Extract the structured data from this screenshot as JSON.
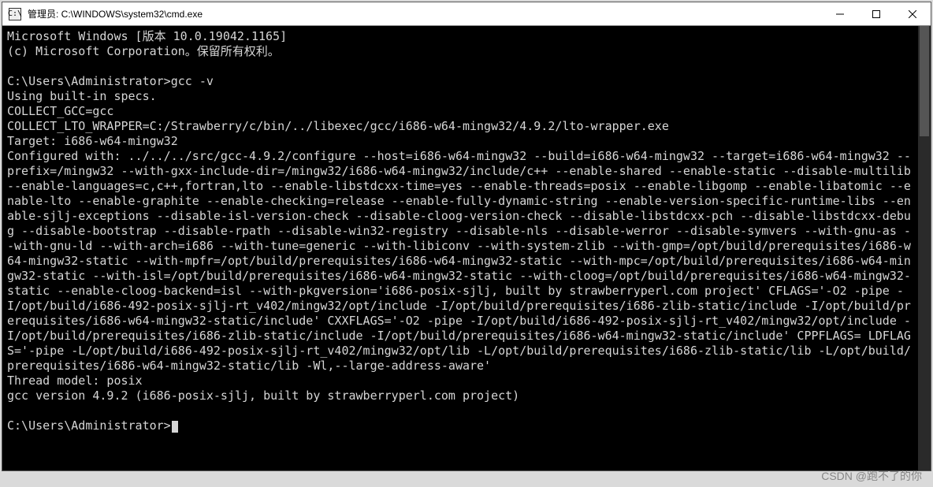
{
  "titlebar": {
    "icon_label": "C:\\",
    "title": "管理员: C:\\WINDOWS\\system32\\cmd.exe"
  },
  "terminal": {
    "line1": "Microsoft Windows [版本 10.0.19042.1165]",
    "line2": "(c) Microsoft Corporation。保留所有权利。",
    "blank1": "",
    "prompt1": "C:\\Users\\Administrator>gcc -v",
    "spec": "Using built-in specs.",
    "collect_gcc": "COLLECT_GCC=gcc",
    "collect_lto": "COLLECT_LTO_WRAPPER=C:/Strawberry/c/bin/../libexec/gcc/i686-w64-mingw32/4.9.2/lto-wrapper.exe",
    "target": "Target: i686-w64-mingw32",
    "configured": "Configured with: ../../../src/gcc-4.9.2/configure --host=i686-w64-mingw32 --build=i686-w64-mingw32 --target=i686-w64-mingw32 --prefix=/mingw32 --with-gxx-include-dir=/mingw32/i686-w64-mingw32/include/c++ --enable-shared --enable-static --disable-multilib --enable-languages=c,c++,fortran,lto --enable-libstdcxx-time=yes --enable-threads=posix --enable-libgomp --enable-libatomic --enable-lto --enable-graphite --enable-checking=release --enable-fully-dynamic-string --enable-version-specific-runtime-libs --enable-sjlj-exceptions --disable-isl-version-check --disable-cloog-version-check --disable-libstdcxx-pch --disable-libstdcxx-debug --disable-bootstrap --disable-rpath --disable-win32-registry --disable-nls --disable-werror --disable-symvers --with-gnu-as --with-gnu-ld --with-arch=i686 --with-tune=generic --with-libiconv --with-system-zlib --with-gmp=/opt/build/prerequisites/i686-w64-mingw32-static --with-mpfr=/opt/build/prerequisites/i686-w64-mingw32-static --with-mpc=/opt/build/prerequisites/i686-w64-mingw32-static --with-isl=/opt/build/prerequisites/i686-w64-mingw32-static --with-cloog=/opt/build/prerequisites/i686-w64-mingw32-static --enable-cloog-backend=isl --with-pkgversion='i686-posix-sjlj, built by strawberryperl.com project' CFLAGS='-O2 -pipe -I/opt/build/i686-492-posix-sjlj-rt_v402/mingw32/opt/include -I/opt/build/prerequisites/i686-zlib-static/include -I/opt/build/prerequisites/i686-w64-mingw32-static/include' CXXFLAGS='-O2 -pipe -I/opt/build/i686-492-posix-sjlj-rt_v402/mingw32/opt/include -I/opt/build/prerequisites/i686-zlib-static/include -I/opt/build/prerequisites/i686-w64-mingw32-static/include' CPPFLAGS= LDFLAGS='-pipe -L/opt/build/i686-492-posix-sjlj-rt_v402/mingw32/opt/lib -L/opt/build/prerequisites/i686-zlib-static/lib -L/opt/build/prerequisites/i686-w64-mingw32-static/lib -Wl,--large-address-aware'",
    "thread_model": "Thread model: posix",
    "gcc_version": "gcc version 4.9.2 (i686-posix-sjlj, built by strawberryperl.com project)",
    "blank2": "",
    "prompt2": "C:\\Users\\Administrator>"
  },
  "watermark": "CSDN @跑不了的你"
}
